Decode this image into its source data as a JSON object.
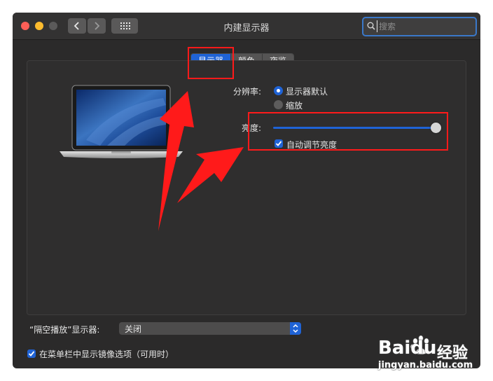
{
  "window": {
    "title": "内建显示器",
    "search": {
      "placeholder": "搜索",
      "value": ""
    }
  },
  "tabs": [
    {
      "label": "显示器",
      "active": true
    },
    {
      "label": "颜色",
      "active": false
    },
    {
      "label": "夜览",
      "active": false
    }
  ],
  "resolution": {
    "label": "分辨率:",
    "options": [
      {
        "label": "显示器默认",
        "selected": true
      },
      {
        "label": "缩放",
        "selected": false
      }
    ]
  },
  "brightness": {
    "label": "亮度:",
    "level_percent": 100,
    "auto_label": "自动调节亮度",
    "auto_checked": true
  },
  "airplay": {
    "label": "“隔空播放”显示器:",
    "selected": "关闭"
  },
  "menubar_option": {
    "label": "在菜单栏中显示镜像选项（可用时）",
    "checked": true
  },
  "watermark": {
    "brand": "Baidu",
    "product": "经验",
    "url": "jingyan.baidu.com"
  },
  "colors": {
    "accent": "#1f63d6",
    "window_bg": "#2b2a2a",
    "annotation_red": "#ff1a1a"
  }
}
